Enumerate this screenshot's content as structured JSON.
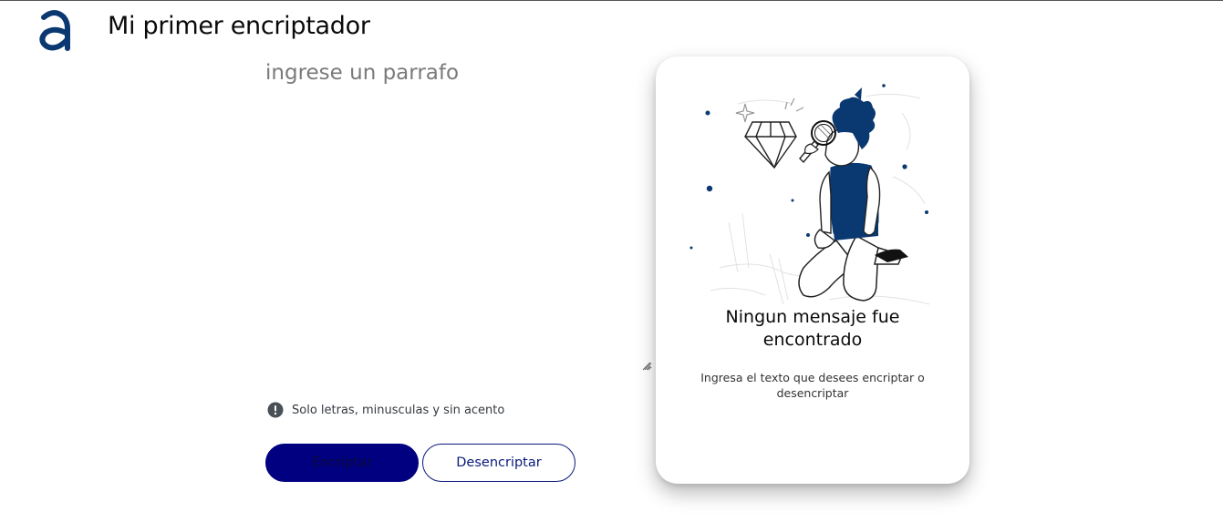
{
  "header": {
    "logo_icon": "alura-a-logo-icon",
    "title": "Mi primer encriptador"
  },
  "input": {
    "placeholder": "ingrese un parrafo",
    "value": ""
  },
  "hint": {
    "icon": "exclamation-circle-icon",
    "text": "Solo letras, minusculas y sin acento"
  },
  "buttons": {
    "encrypt_label": "Encriptar",
    "decrypt_label": "Desencriptar"
  },
  "output_card": {
    "illustration": "person-with-magnifying-glass-diamond-illustration",
    "title": "Ningun mensaje fue encontrado",
    "text": "Ingresa el texto que desees encriptar o desencriptar"
  },
  "colors": {
    "brand": "#0a3871",
    "button_primary": "#000080",
    "button_secondary_border": "#0a1a7a"
  }
}
